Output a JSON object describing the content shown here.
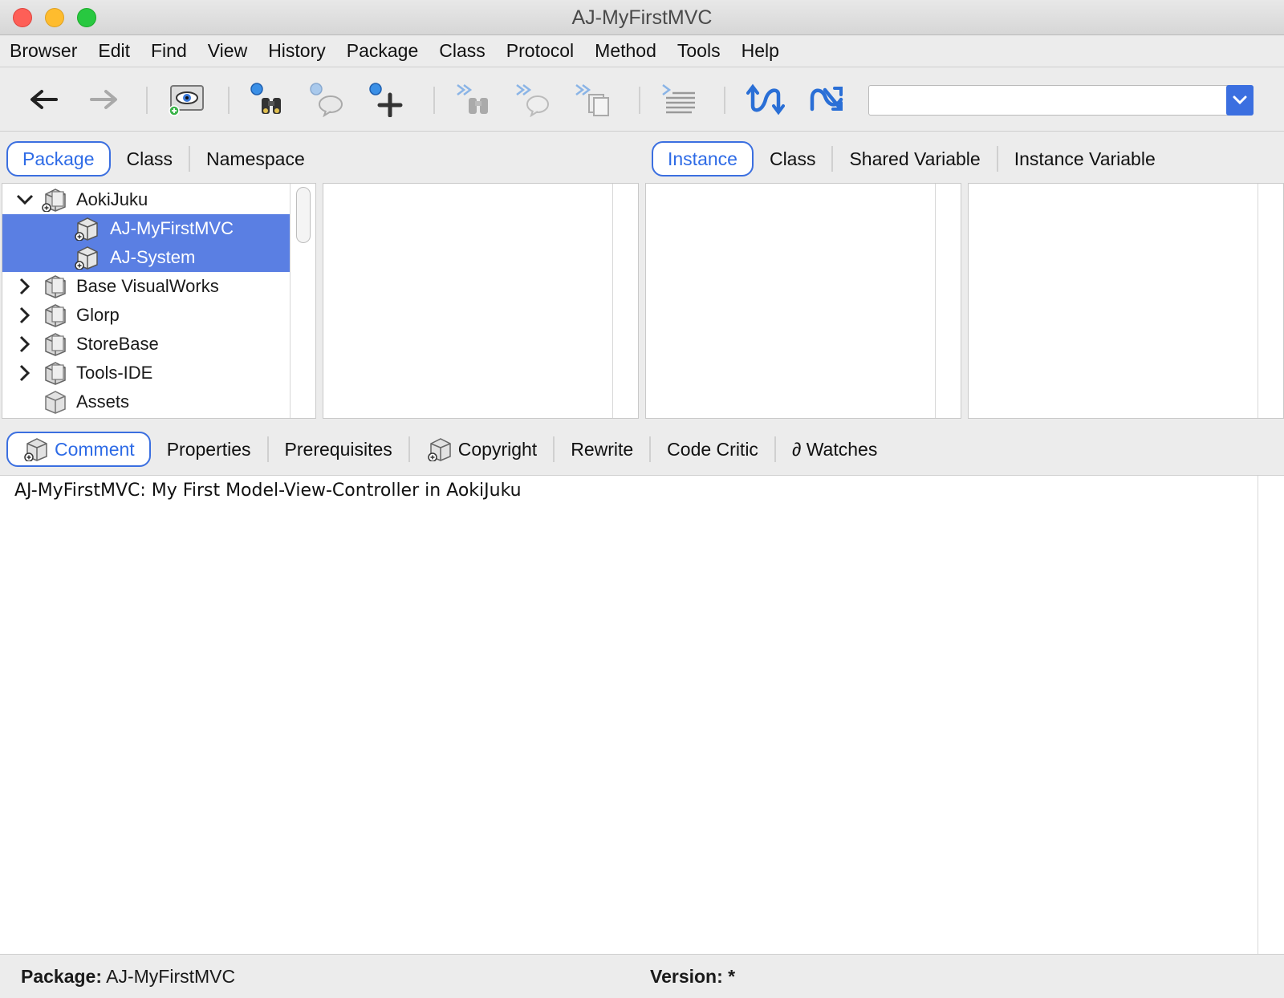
{
  "window": {
    "title": "AJ-MyFirstMVC"
  },
  "menu": [
    "Browser",
    "Edit",
    "Find",
    "View",
    "History",
    "Package",
    "Class",
    "Protocol",
    "Method",
    "Tools",
    "Help"
  ],
  "toolbar": {
    "icons": [
      "back-arrow-icon",
      "forward-arrow-icon",
      "visual-eye-icon",
      "find-binoculars-icon",
      "find-speech-icon",
      "add-plus-icon",
      "find-next-binoculars-icon",
      "find-next-speech-icon",
      "find-next-pages-icon",
      "text-lines-icon",
      "refresh-icon",
      "shuffle-icon"
    ],
    "search_value": ""
  },
  "navigator_tabs": [
    {
      "label": "Package",
      "selected": true
    },
    {
      "label": "Class",
      "selected": false
    },
    {
      "label": "Namespace",
      "selected": false
    }
  ],
  "scope_tabs": [
    {
      "label": "Instance",
      "selected": true
    },
    {
      "label": "Class",
      "selected": false
    },
    {
      "label": "Shared Variable",
      "selected": false
    },
    {
      "label": "Instance Variable",
      "selected": false
    }
  ],
  "package_tree": [
    {
      "label": "AokiJuku",
      "expanded": true,
      "level": 0,
      "selected": false
    },
    {
      "label": "AJ-MyFirstMVC",
      "level": 1,
      "selected": true
    },
    {
      "label": "AJ-System",
      "level": 1,
      "selected": true
    },
    {
      "label": "Base VisualWorks",
      "expanded": false,
      "level": 0,
      "selected": false
    },
    {
      "label": "Glorp",
      "expanded": false,
      "level": 0,
      "selected": false
    },
    {
      "label": "StoreBase",
      "expanded": false,
      "level": 0,
      "selected": false
    },
    {
      "label": "Tools-IDE",
      "expanded": false,
      "level": 0,
      "selected": false
    },
    {
      "label": "Assets",
      "level": 0,
      "selected": false
    }
  ],
  "detail_tabs": [
    {
      "label": "Comment",
      "selected": true,
      "icon": "package-icon"
    },
    {
      "label": "Properties",
      "selected": false
    },
    {
      "label": "Prerequisites",
      "selected": false
    },
    {
      "label": "Copyright",
      "selected": false,
      "icon": "package-icon"
    },
    {
      "label": "Rewrite",
      "selected": false
    },
    {
      "label": "Code Critic",
      "selected": false
    },
    {
      "label": "∂ Watches",
      "selected": false
    }
  ],
  "comment": {
    "text": "AJ-MyFirstMVC: My First Model-View-Controller in AokiJuku"
  },
  "status": {
    "package_label": "Package:",
    "package_value": "AJ-MyFirstMVC",
    "version_label": "Version:",
    "version_value": "*"
  },
  "colors": {
    "accent": "#3b6fe0",
    "selection": "#5a7fe3"
  }
}
